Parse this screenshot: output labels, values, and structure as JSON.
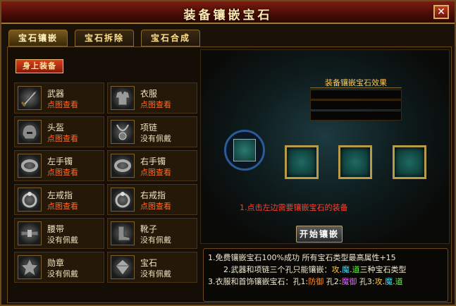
{
  "window": {
    "title": "装备镶嵌宝石"
  },
  "tabs": [
    {
      "label": "宝石镶嵌",
      "active": true
    },
    {
      "label": "宝石拆除",
      "active": false
    },
    {
      "label": "宝石合成",
      "active": false
    }
  ],
  "equip_header": "身上装备",
  "slots": [
    {
      "name": "武器",
      "status": "点图查看",
      "icon": "sword-icon"
    },
    {
      "name": "衣服",
      "status": "点图查看",
      "icon": "armor-icon"
    },
    {
      "name": "头盔",
      "status": "点图查看",
      "icon": "helmet-icon"
    },
    {
      "name": "项链",
      "status": "没有佩戴",
      "icon": "necklace-icon"
    },
    {
      "name": "左手镯",
      "status": "点图查看",
      "icon": "bracelet-icon"
    },
    {
      "name": "右手镯",
      "status": "点图查看",
      "icon": "bracelet-icon"
    },
    {
      "name": "左戒指",
      "status": "点图查看",
      "icon": "ring-icon"
    },
    {
      "name": "右戒指",
      "status": "点图查看",
      "icon": "ring-icon"
    },
    {
      "name": "腰带",
      "status": "没有佩戴",
      "icon": "belt-icon"
    },
    {
      "name": "靴子",
      "status": "没有佩戴",
      "icon": "boots-icon"
    },
    {
      "name": "勋章",
      "status": "没有佩戴",
      "icon": "medal-icon"
    },
    {
      "name": "宝石",
      "status": "没有佩戴",
      "icon": "gem-icon"
    }
  ],
  "effect_title": "装备镶嵌宝石效果",
  "hint": "1.点击左边需要镶嵌宝石的装备",
  "start_button": "开始镶嵌",
  "notes": {
    "line1": "1.免费镶嵌宝石100%成功 所有宝石类型最高属性+15",
    "line2_prefix": "2.武器和项链三个孔只能镶嵌：",
    "line2_a": "攻",
    "line2_b": "魔",
    "line2_c": "道",
    "line2_suffix": "三种宝石类型",
    "line3_prefix": "3.衣服和首饰镶嵌宝石：孔1:",
    "line3_h1": "防御",
    "line3_mid1": " 孔2:",
    "line3_h2": "魔御",
    "line3_mid2": " 孔3:",
    "line3_a": "攻",
    "line3_b": "魔",
    "line3_c": "道"
  },
  "colors": {
    "view_status": "#ff6a2a",
    "hint": "#ff4030",
    "title_bg": "#7a1c10"
  }
}
